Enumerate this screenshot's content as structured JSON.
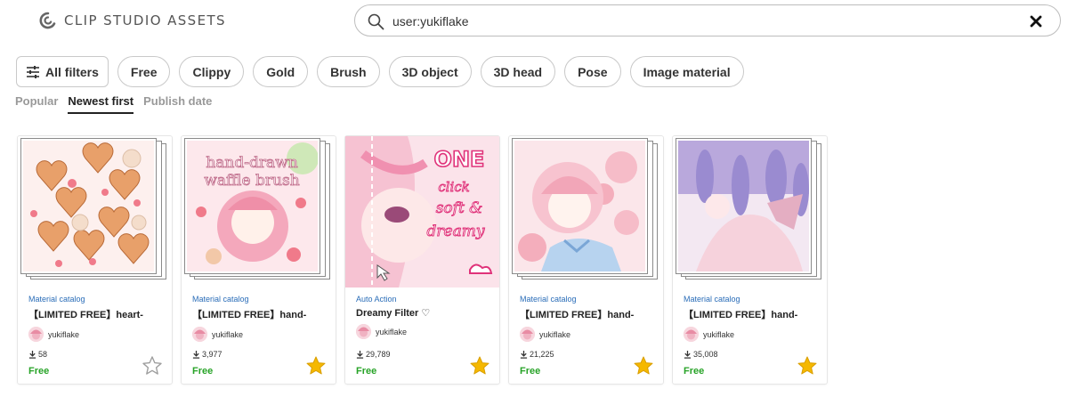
{
  "header": {
    "logo_text": "CLIP STUDIO ASSETS",
    "search_value": "user:yukiflake"
  },
  "filters": [
    {
      "label": "All filters"
    },
    {
      "label": "Free"
    },
    {
      "label": "Clippy"
    },
    {
      "label": "Gold"
    },
    {
      "label": "Brush"
    },
    {
      "label": "3D object"
    },
    {
      "label": "3D head"
    },
    {
      "label": "Pose"
    },
    {
      "label": "Image material"
    }
  ],
  "sort_tabs": [
    {
      "label": "Popular",
      "active": false
    },
    {
      "label": "Newest first",
      "active": true
    },
    {
      "label": "Publish date",
      "active": false
    }
  ],
  "cards": [
    {
      "category": "Material catalog",
      "title": "【LIMITED FREE】heart-",
      "author": "yukiflake",
      "downloads": "58",
      "price": "Free",
      "favorited": false,
      "stacked": true
    },
    {
      "category": "Material catalog",
      "title": "【LIMITED FREE】hand-",
      "author": "yukiflake",
      "downloads": "3,977",
      "price": "Free",
      "favorited": true,
      "stacked": true,
      "thumb_text": "hand-drawn waffle brush"
    },
    {
      "category": "Auto Action",
      "title": "Dreamy Filter ♡",
      "author": "yukiflake",
      "downloads": "29,789",
      "price": "Free",
      "favorited": true,
      "stacked": false,
      "thumb_text": "ONE click soft & dreamy"
    },
    {
      "category": "Material catalog",
      "title": "【LIMITED FREE】hand-",
      "author": "yukiflake",
      "downloads": "21,225",
      "price": "Free",
      "favorited": true,
      "stacked": true
    },
    {
      "category": "Material catalog",
      "title": "【LIMITED FREE】hand-",
      "author": "yukiflake",
      "downloads": "35,008",
      "price": "Free",
      "favorited": true,
      "stacked": true
    }
  ],
  "colors": {
    "category": "#2a6db8",
    "price": "#27a327",
    "star_filled": "#f5b800",
    "star_empty": "#9e9e9e"
  }
}
